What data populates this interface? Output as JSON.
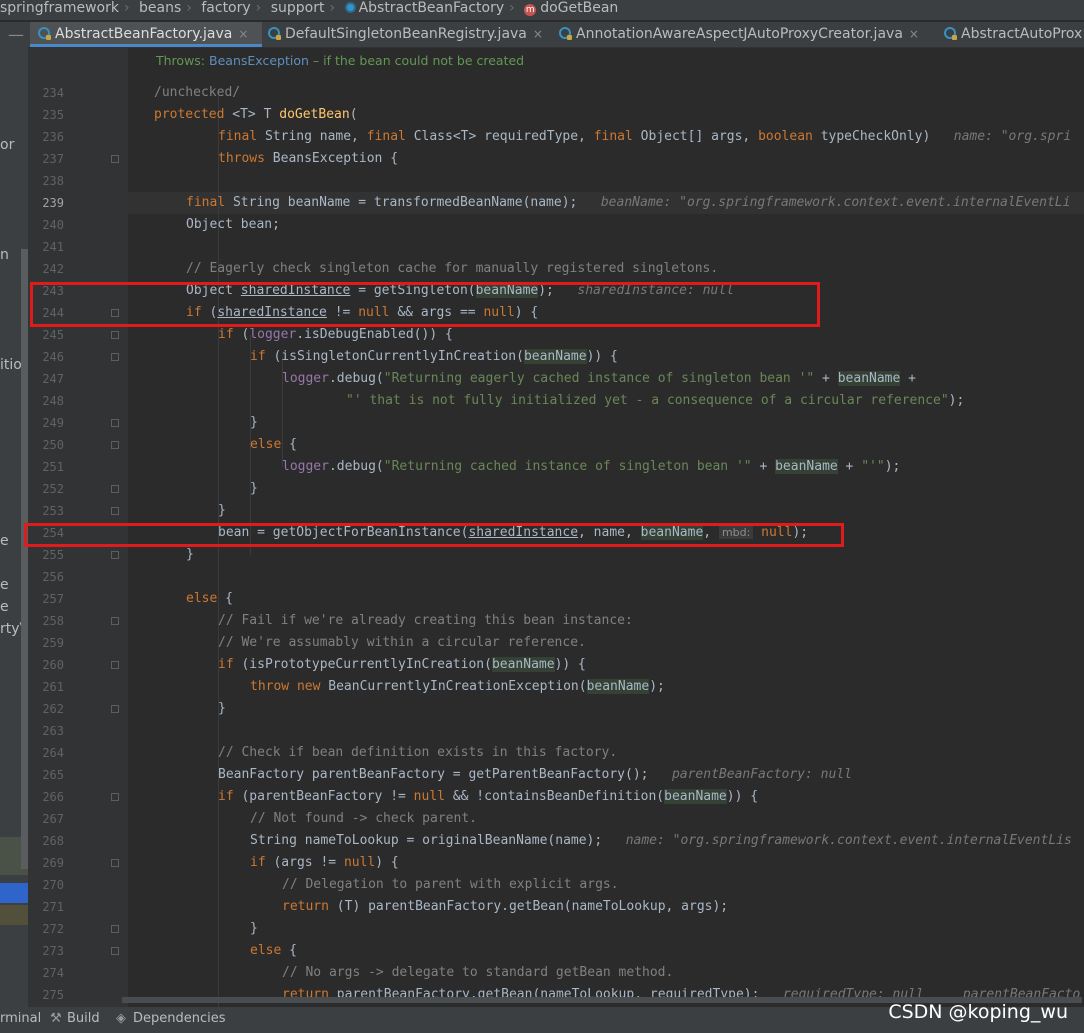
{
  "breadcrumb": [
    "springframework",
    "beans",
    "factory",
    "support",
    "AbstractBeanFactory",
    "doGetBean"
  ],
  "tabs": [
    {
      "label": "AbstractBeanFactory.java",
      "active": true
    },
    {
      "label": "DefaultSingletonBeanRegistry.java",
      "active": false
    },
    {
      "label": "AnnotationAwareAspectJAutoProxyCreator.java",
      "active": false
    },
    {
      "label": "AbstractAutoProx",
      "active": false
    }
  ],
  "tab_close": "×",
  "left_panel_fragments": [
    "or",
    "n",
    "itio",
    "e",
    "e",
    "e",
    "rtyV"
  ],
  "doc_comment": {
    "label": "Throws:",
    "ref": "BeansException",
    "text": " – if the bean could not be created"
  },
  "line_numbers": [
    "234",
    "235",
    "236",
    "237",
    "238",
    "239",
    "240",
    "241",
    "242",
    "243",
    "244",
    "245",
    "246",
    "247",
    "248",
    "249",
    "250",
    "251",
    "252",
    "253",
    "254",
    "255",
    "256",
    "257",
    "258",
    "259",
    "260",
    "261",
    "262",
    "263",
    "264",
    "265",
    "266",
    "267",
    "268",
    "269",
    "270",
    "271",
    "272",
    "273",
    "274",
    "275"
  ],
  "code": {
    "l234": "/unchecked/",
    "l235_a": "protected ",
    "l235_b": "<T> T ",
    "l235_c": "doGetBean",
    "l235_d": "(",
    "l236_a": "final ",
    "l236_b": "String name, ",
    "l236_c": "final ",
    "l236_d": "Class<T> requiredType, ",
    "l236_e": "final ",
    "l236_f": "Object[] args, ",
    "l236_g": "boolean ",
    "l236_h": "typeCheckOnly)",
    "l236_hint": "name: \"org.spri",
    "l237_a": "throws ",
    "l237_b": "BeansException {",
    "l239_a": "final ",
    "l239_b": "String ",
    "l239_c": "beanName",
    "l239_d": " = transformedBeanName(name);",
    "l239_hint": "beanName: \"org.springframework.context.event.internalEventLi",
    "l240": "Object bean;",
    "l242": "// Eagerly check singleton cache for manually registered singletons.",
    "l243_a": "Object ",
    "l243_b": "sharedInstance",
    "l243_c": " = getSingleton(",
    "l243_d": "beanName",
    "l243_e": ");",
    "l243_hint": "sharedInstance: null",
    "l244_a": "if ",
    "l244_b": "(",
    "l244_c": "sharedInstance",
    "l244_d": " != ",
    "l244_e": "null ",
    "l244_f": "&& args == ",
    "l244_g": "null",
    "l244_h": ") {",
    "l245_a": "if ",
    "l245_b": "(",
    "l245_c": "logger",
    "l245_d": ".isDebugEnabled()) {",
    "l246_a": "if ",
    "l246_b": "(isSingletonCurrentlyInCreation(",
    "l246_c": "beanName",
    "l246_d": ")) {",
    "l247_a": "logger",
    "l247_b": ".debug(",
    "l247_c": "\"Returning eagerly cached instance of singleton bean '\"",
    "l247_d": " + ",
    "l247_e": "beanName",
    "l247_f": " +",
    "l248": "\"' that is not fully initialized yet - a consequence of a circular reference\"",
    "l248_end": ");",
    "l249": "}",
    "l250_a": "else ",
    "l250_b": "{",
    "l251_a": "logger",
    "l251_b": ".debug(",
    "l251_c": "\"Returning cached instance of singleton bean '\"",
    "l251_d": " + ",
    "l251_e": "beanName",
    "l251_f": " + ",
    "l251_g": "\"'\"",
    "l251_h": ");",
    "l252": "}",
    "l253": "}",
    "l254_a": "bean = getObjectForBeanInstance(",
    "l254_b": "sharedInstance",
    "l254_c": ", name, ",
    "l254_d": "beanName",
    "l254_e": ", ",
    "l254_mbd": "mbd:",
    "l254_f": " null",
    "l254_g": ");",
    "l255": "}",
    "l257_a": "else ",
    "l257_b": "{",
    "l258": "// Fail if we're already creating this bean instance:",
    "l259": "// We're assumably within a circular reference.",
    "l260_a": "if ",
    "l260_b": "(isPrototypeCurrentlyInCreation(",
    "l260_c": "beanName",
    "l260_d": ")) {",
    "l261_a": "throw new ",
    "l261_b": "BeanCurrentlyInCreationException(",
    "l261_c": "beanName",
    "l261_d": ");",
    "l262": "}",
    "l264": "// Check if bean definition exists in this factory.",
    "l265_a": "BeanFactory parentBeanFactory = getParentBeanFactory();",
    "l265_hint": "parentBeanFactory: null",
    "l266_a": "if ",
    "l266_b": "(parentBeanFactory != ",
    "l266_c": "null ",
    "l266_d": "&& !containsBeanDefinition(",
    "l266_e": "beanName",
    "l266_f": ")) {",
    "l267": "// Not found -> check parent.",
    "l268_a": "String nameToLookup = originalBeanName(name);",
    "l268_hint": "name: \"org.springframework.context.event.internalEventLis",
    "l269_a": "if ",
    "l269_b": "(args != ",
    "l269_c": "null",
    "l269_d": ") {",
    "l270": "// Delegation to parent with explicit args.",
    "l271_a": "return ",
    "l271_b": "(T) parentBeanFactory.getBean(nameToLookup, args);",
    "l272": "}",
    "l273_a": "else ",
    "l273_b": "{",
    "l274": "// No args -> delegate to standard getBean method.",
    "l275_a": "return ",
    "l275_b": "parentBeanFactory.getBean(nameToLookup, requiredType);",
    "l275_hint": "requiredType: null     parentBeanFacto"
  },
  "bottom": {
    "terminal": "rminal",
    "build": "Build",
    "dependencies": "Dependencies"
  },
  "watermark": "CSDN @koping_wu"
}
